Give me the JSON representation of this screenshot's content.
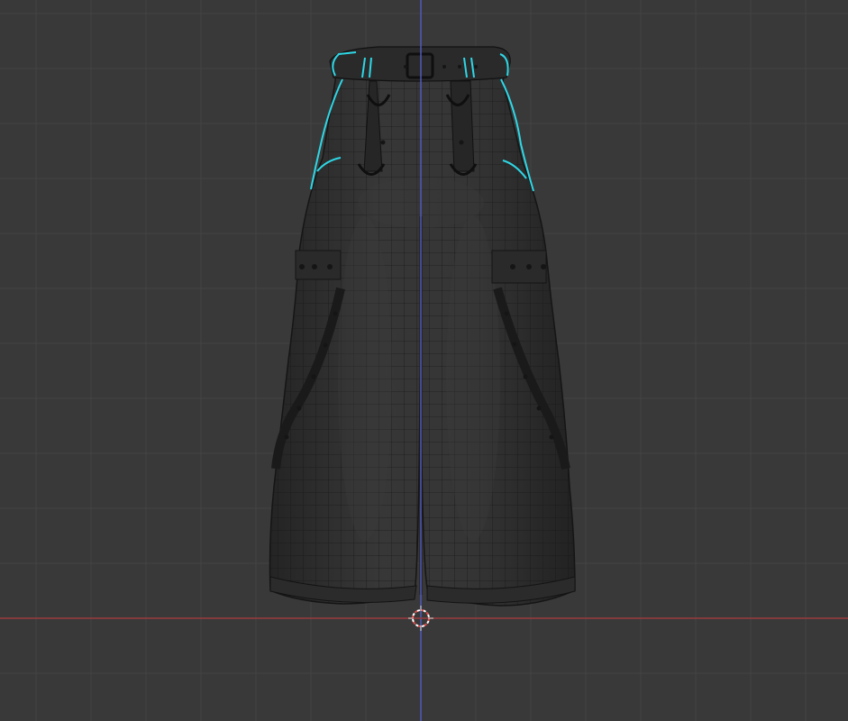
{
  "viewport": {
    "background_color": "#393939",
    "grid_color": "#444444",
    "grid_major_color": "#4a4a4a",
    "x_axis_color": "#9a3b3d",
    "y_axis_color": "#4f5ab8",
    "selection_color": "#2ed7e6",
    "wire_color": "#111111",
    "mesh_color": "#2f2f2f"
  },
  "scene": {
    "object": "pants-mesh",
    "display_mode": "solid-with-wireframe",
    "selected_edges": "waistband-outline",
    "cursor_icon": "3d-cursor-icon"
  }
}
